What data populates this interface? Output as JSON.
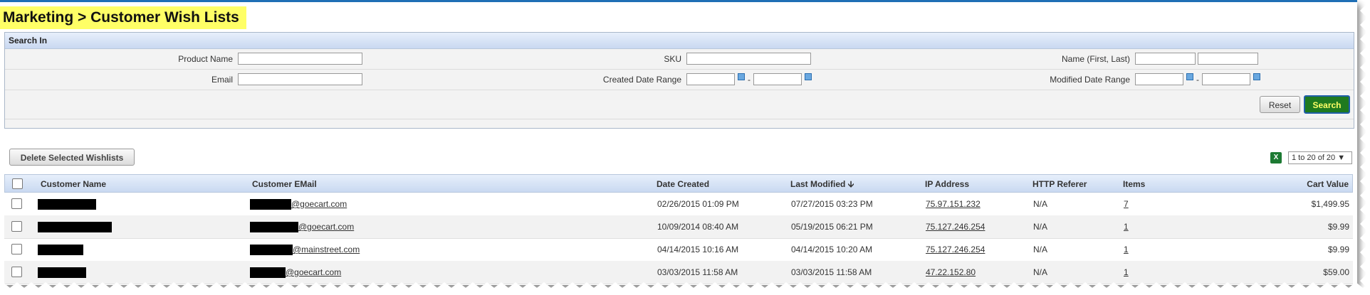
{
  "page_title": "Marketing > Customer Wish Lists",
  "search": {
    "header": "Search In",
    "product_name_label": "Product Name",
    "sku_label": "SKU",
    "name_label": "Name (First, Last)",
    "email_label": "Email",
    "created_label": "Created Date Range",
    "modified_label": "Modified Date Range",
    "range_sep": "-",
    "reset_label": "Reset",
    "search_label": "Search"
  },
  "toolbar": {
    "delete_label": "Delete Selected Wishlists",
    "excel_icon": "excel-icon",
    "pager_text": "1 to 20 of 20 ▼"
  },
  "grid": {
    "headers": {
      "name": "Customer Name",
      "email": "Customer EMail",
      "created": "Date Created",
      "modified": "Last Modified",
      "sort_arrow": "🡫",
      "ip": "IP Address",
      "referer": "HTTP Referer",
      "items": "Items",
      "value": "Cart Value"
    },
    "rows": [
      {
        "email_domain": "@goecart.com",
        "created": "02/26/2015 01:09 PM",
        "modified": "07/27/2015 03:23 PM",
        "ip": "75.97.151.232",
        "referer": "N/A",
        "items": "7",
        "value": "$1,499.95"
      },
      {
        "email_domain": "@goecart.com",
        "created": "10/09/2014 08:40 AM",
        "modified": "05/19/2015 06:21 PM",
        "ip": "75.127.246.254",
        "referer": "N/A",
        "items": "1",
        "value": "$9.99"
      },
      {
        "email_domain": "@mainstreet.com",
        "created": "04/14/2015 10:16 AM",
        "modified": "04/14/2015 10:20 AM",
        "ip": "75.127.246.254",
        "referer": "N/A",
        "items": "1",
        "value": "$9.99"
      },
      {
        "email_domain": "@goecart.com",
        "created": "03/03/2015 11:58 AM",
        "modified": "03/03/2015 11:58 AM",
        "ip": "47.22.152.80",
        "referer": "N/A",
        "items": "1",
        "value": "$59.00"
      }
    ]
  },
  "colors": {
    "accent": "#1f6fb5",
    "title_highlight": "#ffff66",
    "search_button": "#1f7a1f"
  }
}
